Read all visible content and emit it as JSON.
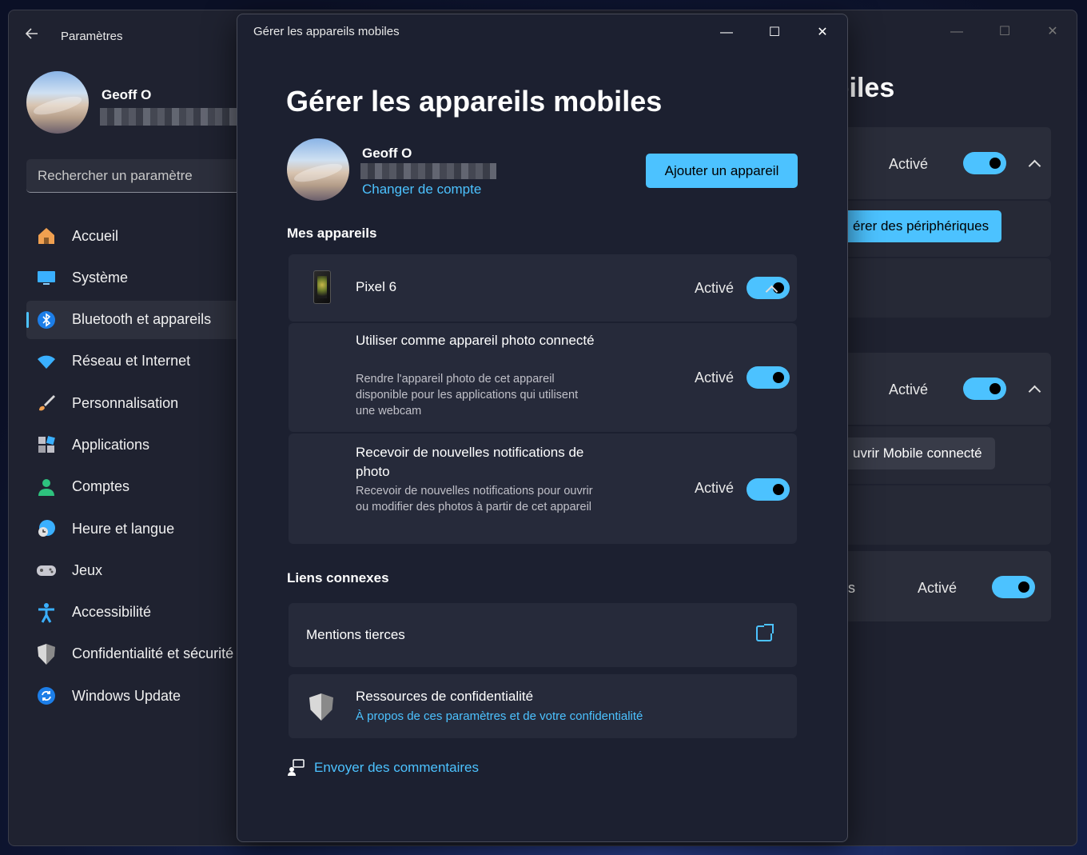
{
  "background_window": {
    "app_title": "Paramètres",
    "user_name": "Geoff O",
    "search_placeholder": "Rechercher un paramètre",
    "nav_items": [
      {
        "label": "Accueil",
        "icon": "home-icon"
      },
      {
        "label": "Système",
        "icon": "monitor-icon"
      },
      {
        "label": "Bluetooth et appareils",
        "icon": "bluetooth-icon"
      },
      {
        "label": "Réseau et Internet",
        "icon": "wifi-icon"
      },
      {
        "label": "Personnalisation",
        "icon": "paintbrush-icon"
      },
      {
        "label": "Applications",
        "icon": "apps-icon"
      },
      {
        "label": "Comptes",
        "icon": "person-icon"
      },
      {
        "label": "Heure et langue",
        "icon": "globe-clock-icon"
      },
      {
        "label": "Jeux",
        "icon": "gamepad-icon"
      },
      {
        "label": "Accessibilité",
        "icon": "accessibility-icon"
      },
      {
        "label": "Confidentialité et sécurité",
        "icon": "shield-icon"
      },
      {
        "label": "Windows Update",
        "icon": "update-icon"
      }
    ],
    "selected_nav_index": 2,
    "heading_partial": "obiles",
    "rows": [
      {
        "status": "Activé"
      },
      {
        "button": "érer des périphériques"
      },
      {
        "status": "Activé"
      },
      {
        "button": "uvrir Mobile connecté"
      },
      {
        "prefix": "s",
        "status": "Activé"
      }
    ]
  },
  "modal": {
    "window_title": "Gérer les appareils mobiles",
    "heading": "Gérer les appareils mobiles",
    "user_name": "Geoff O",
    "change_account_link": "Changer de compte",
    "add_device_button": "Ajouter un appareil",
    "my_devices_section": "Mes appareils",
    "device": {
      "name": "Pixel 6",
      "status": "Activé"
    },
    "settings": [
      {
        "title": "Utiliser comme appareil photo connecté",
        "description": "Rendre l'appareil photo de cet appareil disponible pour les applications qui utilisent une webcam",
        "status": "Activé"
      },
      {
        "title": "Recevoir de nouvelles notifications de photo",
        "description": "Recevoir de nouvelles notifications pour ouvrir ou modifier des photos à partir de cet appareil",
        "status": "Activé"
      }
    ],
    "related_links_section": "Liens connexes",
    "third_party": "Mentions tierces",
    "privacy_title": "Ressources de confidentialité",
    "privacy_link": "À propos de ces paramètres et de votre confidentialité",
    "feedback_link": "Envoyer des commentaires"
  },
  "colors": {
    "accent": "#4cc2ff",
    "window_bg": "#1c2030",
    "card_bg": "#262a3a"
  }
}
